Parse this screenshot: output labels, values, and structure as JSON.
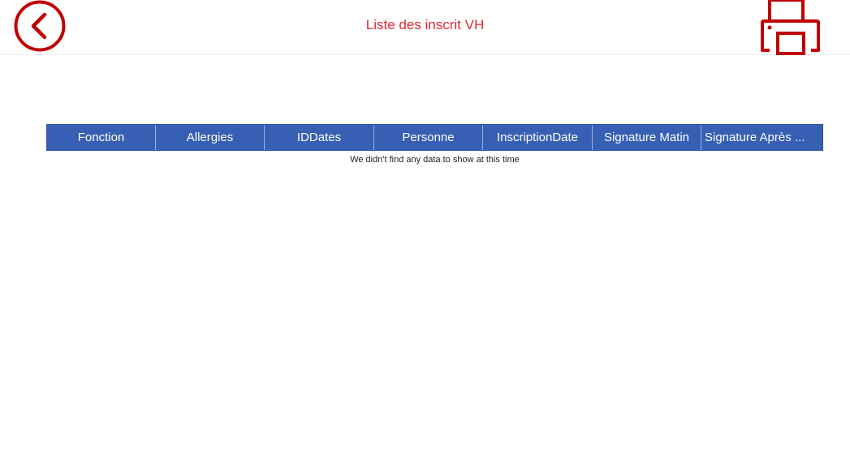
{
  "header": {
    "title": "Liste des inscrit VH",
    "back_icon": "chevron-left-circle-icon",
    "print_icon": "printer-icon",
    "accent_color": "#c00000"
  },
  "grid": {
    "header_color": "#375fb3",
    "columns": [
      {
        "label": "Fonction"
      },
      {
        "label": "Allergies"
      },
      {
        "label": "IDDates"
      },
      {
        "label": "Personne"
      },
      {
        "label": "InscriptionDate"
      },
      {
        "label": "Signature Matin"
      },
      {
        "label": "Signature Après ..."
      }
    ],
    "rows": [],
    "empty_message": "We didn't find any data to show at this time"
  }
}
